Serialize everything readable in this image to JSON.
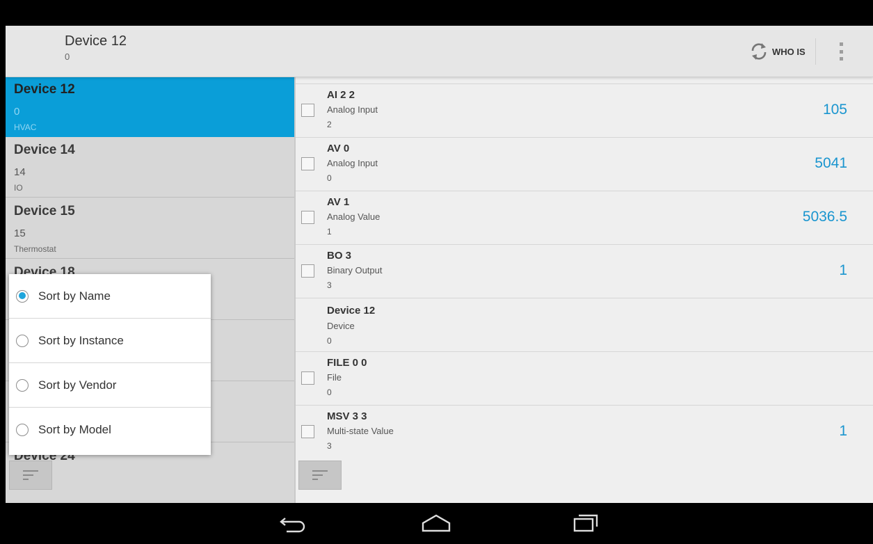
{
  "action_bar": {
    "title": "Device 12",
    "subtitle": "0",
    "whois_label": "WHO IS",
    "whois_icon": "refresh-icon",
    "overflow_icon": "more-vert-icon"
  },
  "devices": [
    {
      "name": "Device 12",
      "instance": "0",
      "type": "HVAC",
      "selected": true
    },
    {
      "name": "Device 14",
      "instance": "14",
      "type": "IO",
      "selected": false
    },
    {
      "name": "Device 15",
      "instance": "15",
      "type": "Thermostat",
      "selected": false
    },
    {
      "name": "Device 18",
      "instance": "",
      "type": "",
      "selected": false
    },
    {
      "name": "",
      "instance": "",
      "type": "",
      "selected": false
    },
    {
      "name": "",
      "instance": "",
      "type": "",
      "selected": false
    },
    {
      "name": "Device 24",
      "instance": "",
      "type": "",
      "selected": false
    }
  ],
  "sort_menu": {
    "options": [
      {
        "label": "Sort by Name",
        "checked": true
      },
      {
        "label": "Sort by Instance",
        "checked": false
      },
      {
        "label": "Sort by Vendor",
        "checked": false
      },
      {
        "label": "Sort by Model",
        "checked": false
      }
    ]
  },
  "objects": [
    {
      "name": "AI 2 2",
      "type": "Analog Input",
      "instance": "2",
      "value": "105",
      "checkbox": true
    },
    {
      "name": "AV 0",
      "type": "Analog Input",
      "instance": "0",
      "value": "5041",
      "checkbox": true
    },
    {
      "name": "AV 1",
      "type": "Analog Value",
      "instance": "1",
      "value": "5036.5",
      "checkbox": true
    },
    {
      "name": "BO 3",
      "type": "Binary Output",
      "instance": "3",
      "value": "1",
      "checkbox": true
    },
    {
      "name": "Device 12",
      "type": "Device",
      "instance": "0",
      "value": "",
      "checkbox": false
    },
    {
      "name": "FILE 0 0",
      "type": "File",
      "instance": "0",
      "value": "",
      "checkbox": true
    },
    {
      "name": "MSV 3 3",
      "type": "Multi-state Value",
      "instance": "3",
      "value": "1",
      "checkbox": true
    }
  ],
  "icons": {
    "sort_left": "sort-icon",
    "sort_right": "sort-icon",
    "nav_back": "back-icon",
    "nav_home": "home-icon",
    "nav_recents": "recents-icon"
  },
  "colors": {
    "accent": "#0a9ed8",
    "value_text": "#1a95cf",
    "radio_on": "#1ea5dc"
  }
}
